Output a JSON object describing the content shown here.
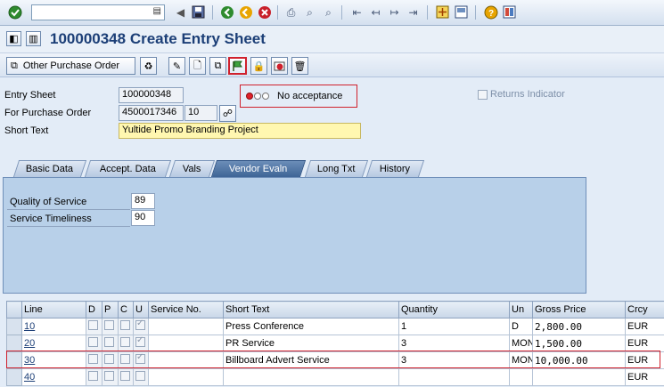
{
  "header": {
    "title": "100000348 Create Entry Sheet",
    "other_po_label": "Other Purchase Order"
  },
  "fields": {
    "entry_sheet_label": "Entry Sheet",
    "entry_sheet_value": "100000348",
    "po_label": "For Purchase Order",
    "po_value": "4500017346",
    "po_item": "10",
    "short_text_label": "Short Text",
    "short_text_value": "Yultide Promo Branding Project",
    "status_text": "No acceptance",
    "returns_label": "Returns Indicator"
  },
  "tabs": [
    {
      "label": "Basic Data"
    },
    {
      "label": "Accept. Data"
    },
    {
      "label": "Vals"
    },
    {
      "label": "Vendor Evaln"
    },
    {
      "label": "Long Txt"
    },
    {
      "label": "History"
    }
  ],
  "active_tab": "Vendor Evaln",
  "vendor_eval": {
    "quality_label": "Quality of Service",
    "quality_value": "89",
    "timeliness_label": "Service Timeliness",
    "timeliness_value": "90"
  },
  "table": {
    "columns": [
      "Line",
      "D",
      "P",
      "C",
      "U",
      "Service No.",
      "Short Text",
      "Quantity",
      "Un",
      "Gross Price",
      "Crcy"
    ],
    "rows": [
      {
        "line": "10",
        "short_text": "Press Conference",
        "quantity": "1",
        "unit": "D",
        "price": "2,800.00",
        "crcy": "EUR"
      },
      {
        "line": "20",
        "short_text": "PR Service",
        "quantity": "3",
        "unit": "MON",
        "price": "1,500.00",
        "crcy": "EUR"
      },
      {
        "line": "30",
        "short_text": "Billboard Advert Service",
        "quantity": "3",
        "unit": "MON",
        "price": "10,000.00",
        "crcy": "EUR"
      },
      {
        "line": "40",
        "short_text": "",
        "quantity": "",
        "unit": "",
        "price": "",
        "crcy": "EUR"
      }
    ]
  },
  "colors": {
    "title": "#1c3f77",
    "highlight": "#d0212d",
    "panel": "#b8d0e9",
    "active_tab": "#3e6596"
  }
}
